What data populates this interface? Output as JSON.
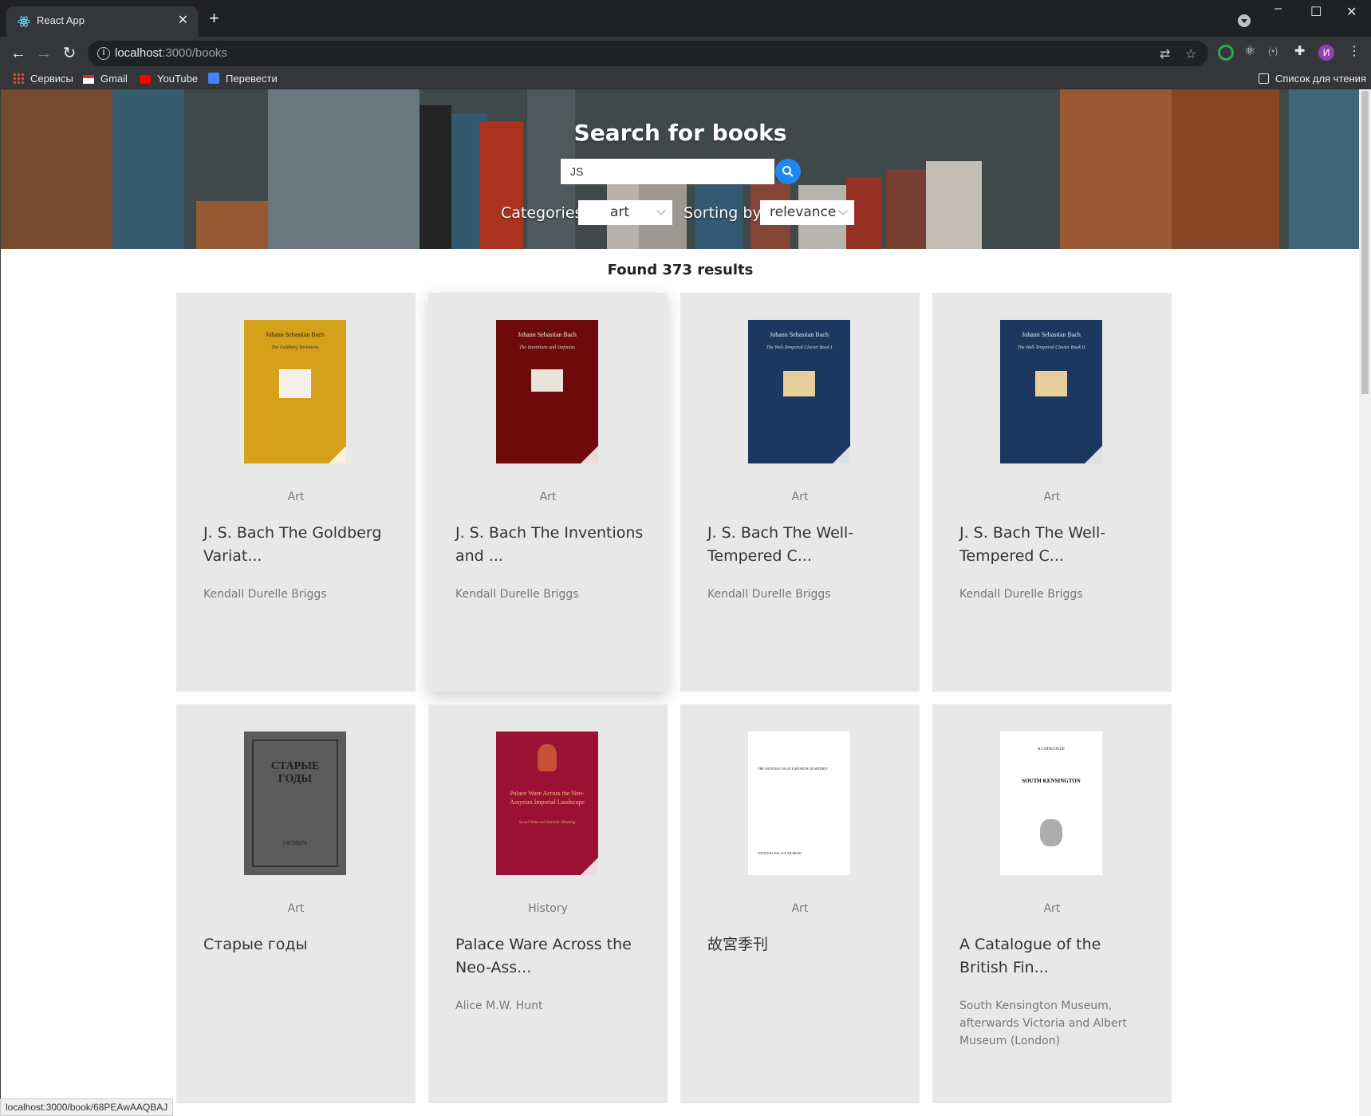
{
  "browser": {
    "tab_title": "React App",
    "tab_close": "✕",
    "new_tab": "+",
    "url_host": "localhost",
    "url_path": ":3000/books",
    "bookmarks": [
      {
        "label": "Сервисы",
        "icon": "apps-grid-icon"
      },
      {
        "label": "Gmail",
        "icon": "gmail-icon"
      },
      {
        "label": "YouTube",
        "icon": "youtube-icon"
      },
      {
        "label": "Перевести",
        "icon": "translate-icon"
      }
    ],
    "reading_list": "Список для чтения",
    "profile_initial": "И",
    "status_url": "localhost:3000/book/68PEAwAAQBAJ"
  },
  "hero": {
    "title": "Search for books",
    "search_value": "JS",
    "categories_label": "Categories",
    "category_selected": "art",
    "sorting_label": "Sorting by",
    "sorting_selected": "relevance"
  },
  "results_text": "Found 373 results",
  "books": [
    {
      "category": "Art",
      "title": "J. S. Bach The Goldberg Variat...",
      "author": "Kendall Durelle Briggs",
      "cover_color": "#d6a11a",
      "cover_heading": "Johann Sebastian Bach",
      "cover_sub": "The Goldberg Variations"
    },
    {
      "category": "Art",
      "title": "J. S. Bach The Inventions and ...",
      "author": "Kendall Durelle Briggs",
      "cover_color": "#6e0a0a",
      "cover_heading": "Johann Sebastian Bach",
      "cover_sub": "The Inventions and Sinfonias"
    },
    {
      "category": "Art",
      "title": "J. S. Bach The Well-Tempered C...",
      "author": "Kendall Durelle Briggs",
      "cover_color": "#1c3760",
      "cover_heading": "Johann Sebastian Bach",
      "cover_sub": "The Well-Tempered Clavier Book I"
    },
    {
      "category": "Art",
      "title": "J. S. Bach The Well-Tempered C...",
      "author": "Kendall Durelle Briggs",
      "cover_color": "#1c3760",
      "cover_heading": "Johann Sebastian Bach",
      "cover_sub": "The Well-Tempered Clavier Book II"
    },
    {
      "category": "Art",
      "title": "Старые годы",
      "author": "",
      "cover_color": "#5c5c5c",
      "cover_heading": "СТАРЫЕ ГОДЫ",
      "cover_sub": "ОКТЯБРЬ"
    },
    {
      "category": "History",
      "title": "Palace Ware Across the Neo-Ass...",
      "author": "Alice M.W. Hunt",
      "cover_color": "#9b1134",
      "cover_heading": "Palace Ware Across the Neo-Assyrian Imperial Landscape",
      "cover_sub": "Social Value and Semiotic Meaning"
    },
    {
      "category": "Art",
      "title": "故宮季刊",
      "author": "",
      "cover_color": "#ffffff",
      "cover_heading": "THE NATIONAL PALACE MUSEUM QUARTERLY",
      "cover_sub": "NATIONAL PALACE MUSEUM"
    },
    {
      "category": "Art",
      "title": "A Catalogue of the British Fin...",
      "author": "South Kensington Museum, afterwards Victoria and Albert Museum (London)",
      "cover_color": "#ffffff",
      "cover_heading": "A CATALOGUE",
      "cover_sub": "SOUTH KENSINGTON"
    }
  ]
}
